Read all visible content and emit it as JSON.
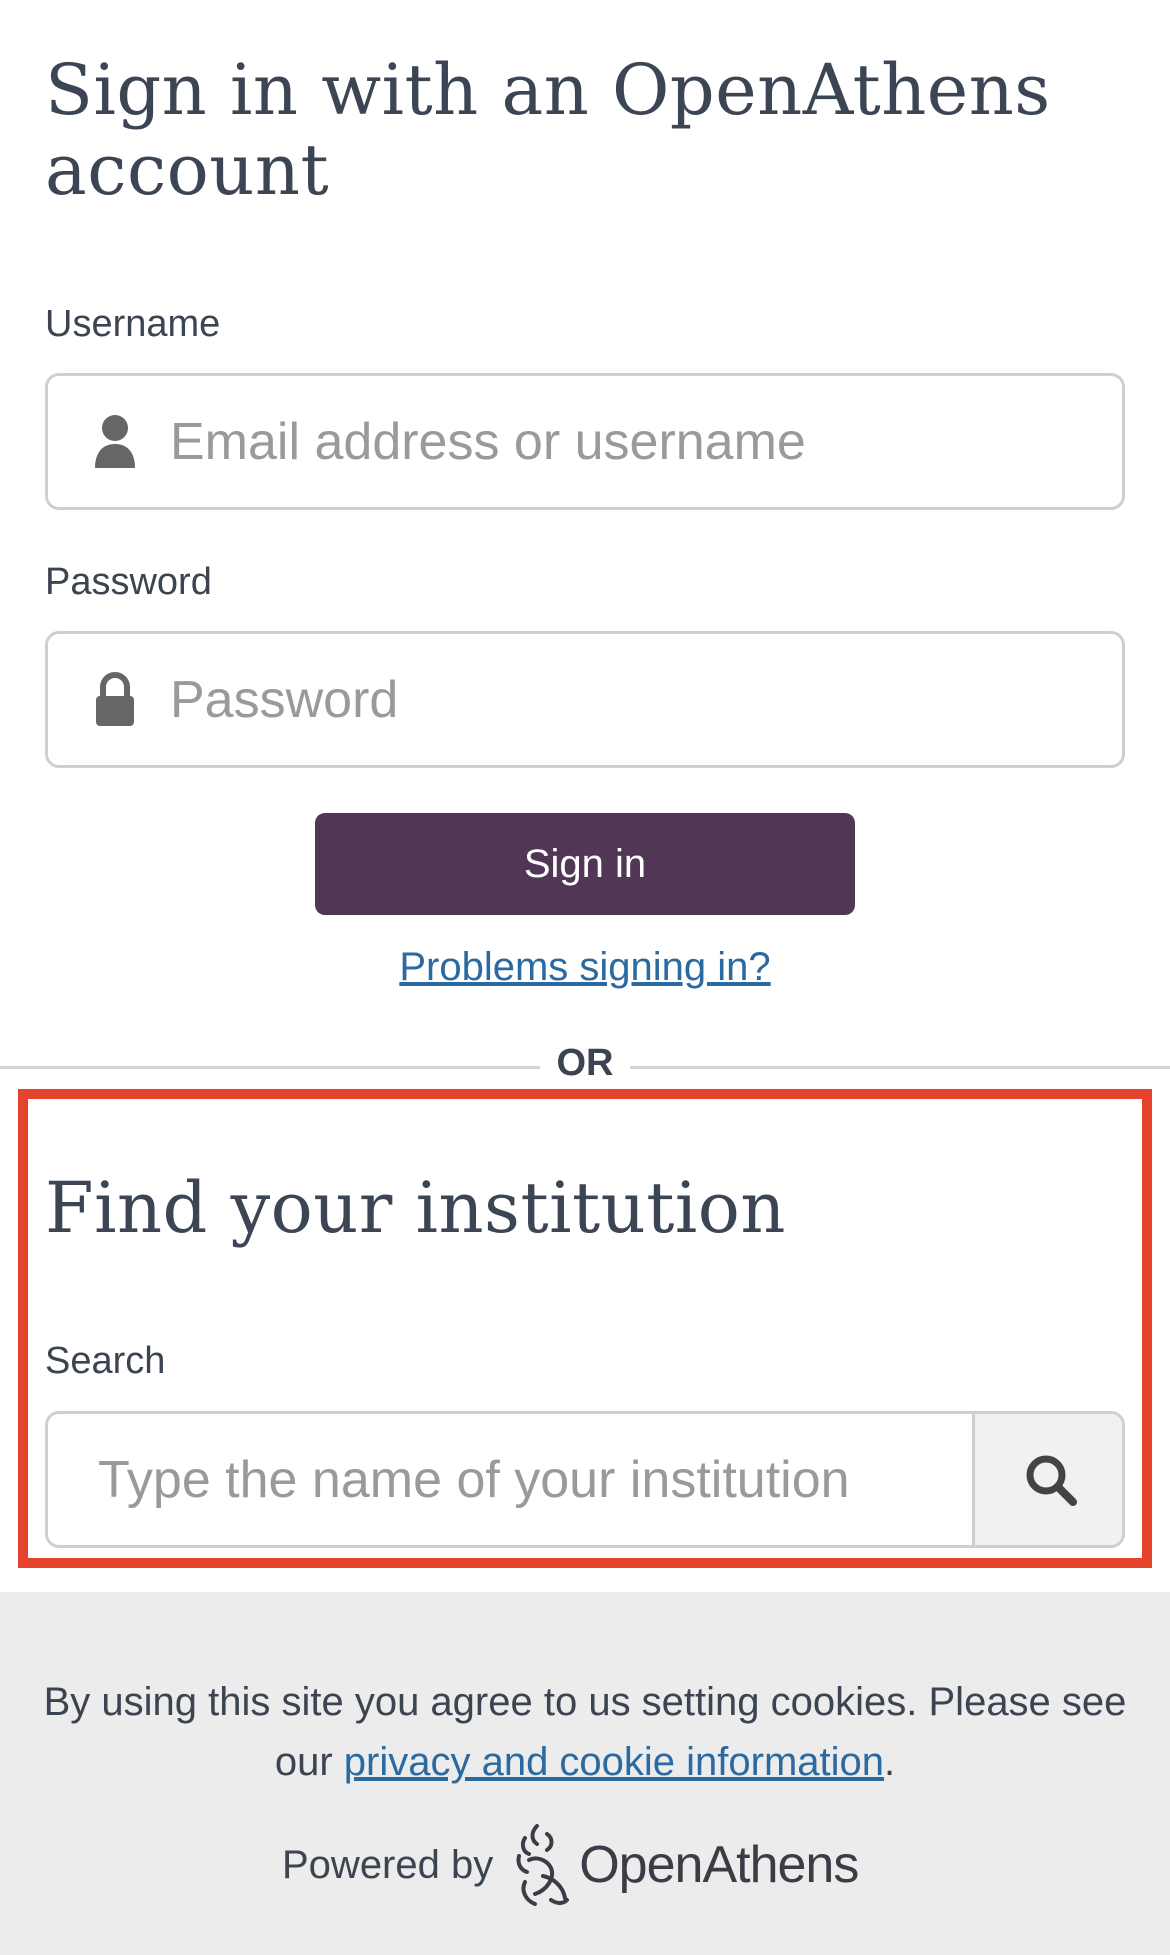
{
  "page_title": "Sign in with an OpenAthens account",
  "username": {
    "label": "Username",
    "placeholder": "Email address or username",
    "value": ""
  },
  "password": {
    "label": "Password",
    "placeholder": "Password",
    "value": ""
  },
  "signin_button": "Sign in",
  "problems_link": "Problems signing in?",
  "divider_text": "OR",
  "institution": {
    "title": "Find your institution",
    "search_label": "Search",
    "search_placeholder": "Type the name of your institution"
  },
  "footer": {
    "cookie_text_before": "By using this site you agree to us setting cookies. Please see our ",
    "cookie_link": "privacy and cookie information",
    "cookie_text_after": ".",
    "powered_by": "Powered by",
    "brand_name": "OpenAthens"
  },
  "icons": {
    "username": "user-icon",
    "password": "lock-icon",
    "search": "search-icon",
    "logo": "openathens-logo-icon"
  },
  "colors": {
    "primary_button": "#523656",
    "link": "#2b69a1",
    "highlight_border": "#e5432d",
    "footer_bg": "#ececec"
  }
}
